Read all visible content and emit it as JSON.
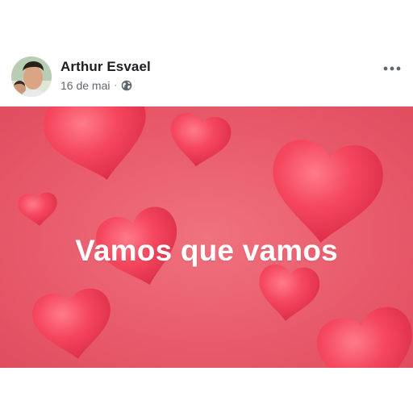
{
  "post": {
    "author": "Arthur Esvael",
    "date": "16 de mai",
    "separator": "·",
    "privacy_icon": "globe-icon",
    "menu_icon": "more-horizontal-icon"
  },
  "image": {
    "overlay_text": "Vamos que vamos",
    "background_color": "#e85a6b",
    "heart_color": "#f0334f"
  }
}
